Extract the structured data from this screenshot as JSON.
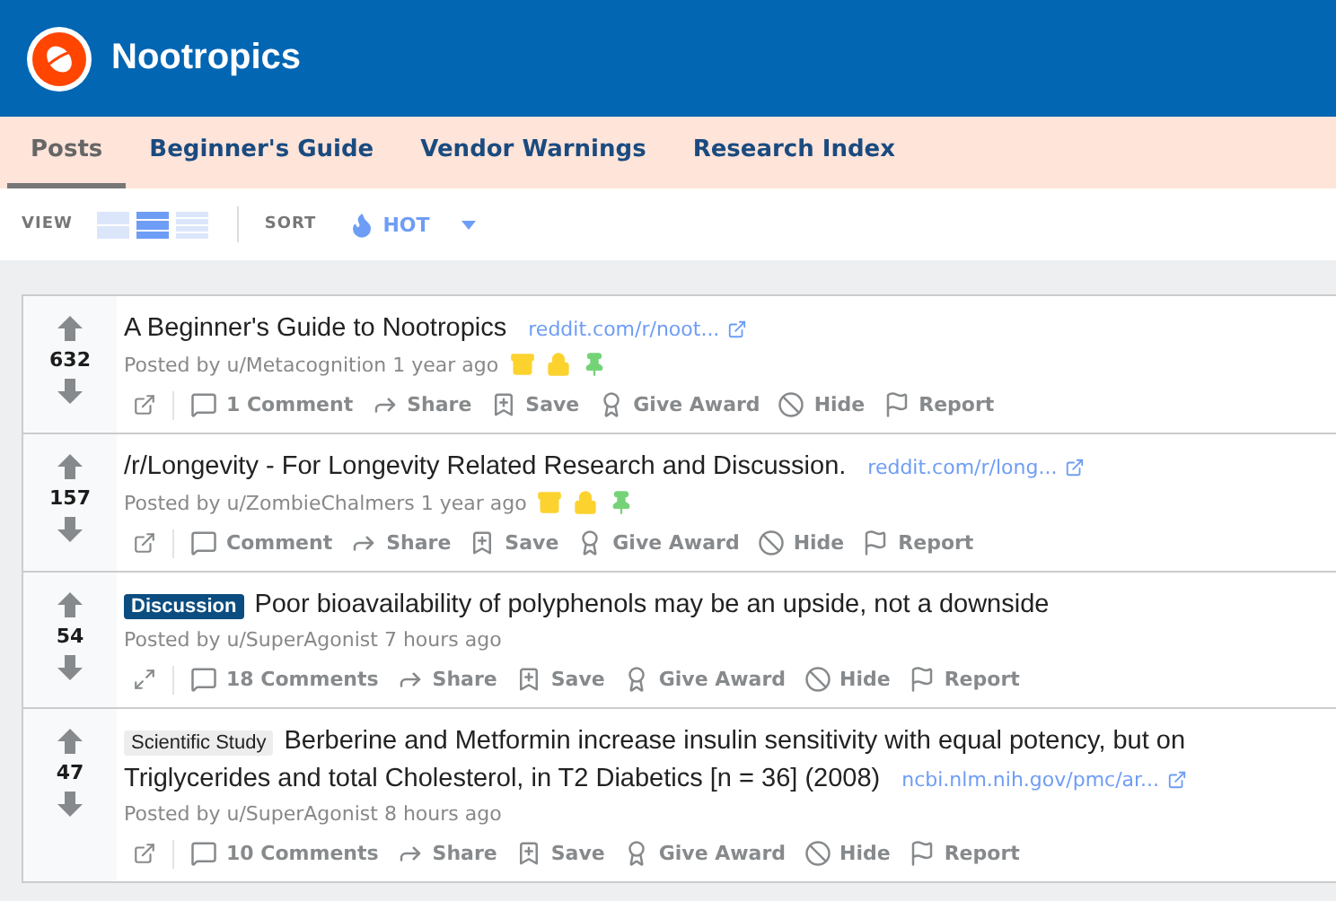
{
  "header": {
    "title": "Nootropics"
  },
  "tabs": [
    {
      "label": "Posts",
      "selected": true
    },
    {
      "label": "Beginner's Guide",
      "selected": false
    },
    {
      "label": "Vendor Warnings",
      "selected": false
    },
    {
      "label": "Research Index",
      "selected": false
    }
  ],
  "toolbar": {
    "view_label": "VIEW",
    "views": [
      {
        "kind": "card",
        "selected": false
      },
      {
        "kind": "classic",
        "selected": true
      },
      {
        "kind": "compact",
        "selected": false
      }
    ],
    "sort_label": "SORT",
    "sort_value": "HOT"
  },
  "posts": [
    {
      "votes": "632",
      "title_lines": [
        "A Beginner's Guide to Nootropics"
      ],
      "domain": "reddit.com/r/noot...",
      "meta": "Posted by u/Metacognition 1 year ago",
      "badges": [
        {
          "kind": "archived"
        },
        {
          "kind": "locked"
        },
        {
          "kind": "pinned"
        }
      ],
      "open_button": {
        "kind": "external"
      },
      "actions": [
        {
          "kind": "comment",
          "label": "1 Comment"
        },
        {
          "kind": "share",
          "label": "Share"
        },
        {
          "kind": "save",
          "label": "Save"
        },
        {
          "kind": "award",
          "label": "Give Award"
        },
        {
          "kind": "hide",
          "label": "Hide"
        },
        {
          "kind": "report",
          "label": "Report"
        }
      ]
    },
    {
      "votes": "157",
      "title_lines": [
        "/r/Longevity - For Longevity Related Research and Discussion."
      ],
      "domain": "reddit.com/r/long...",
      "meta": "Posted by u/ZombieChalmers 1 year ago",
      "badges": [
        {
          "kind": "archived"
        },
        {
          "kind": "locked"
        },
        {
          "kind": "pinned"
        }
      ],
      "open_button": {
        "kind": "external"
      },
      "actions": [
        {
          "kind": "comment",
          "label": "Comment"
        },
        {
          "kind": "share",
          "label": "Share"
        },
        {
          "kind": "save",
          "label": "Save"
        },
        {
          "kind": "award",
          "label": "Give Award"
        },
        {
          "kind": "hide",
          "label": "Hide"
        },
        {
          "kind": "report",
          "label": "Report"
        }
      ]
    },
    {
      "votes": "54",
      "flair": {
        "text": "Discussion",
        "kind": "dark"
      },
      "title_lines": [
        "Poor bioavailability of polyphenols may be an upside, not a downside"
      ],
      "meta": "Posted by u/SuperAgonist 7 hours ago",
      "open_button": {
        "kind": "expand"
      },
      "actions": [
        {
          "kind": "comment",
          "label": "18 Comments"
        },
        {
          "kind": "share",
          "label": "Share"
        },
        {
          "kind": "save",
          "label": "Save"
        },
        {
          "kind": "award",
          "label": "Give Award"
        },
        {
          "kind": "hide",
          "label": "Hide"
        },
        {
          "kind": "report",
          "label": "Report"
        }
      ]
    },
    {
      "votes": "47",
      "flair": {
        "text": "Scientific Study",
        "kind": "light"
      },
      "title_lines": [
        "Berberine and Metformin increase insulin sensitivity with equal potency, but on",
        "Triglycerides and total Cholesterol, in T2 Diabetics [n = 36] (2008)"
      ],
      "domain": "ncbi.nlm.nih.gov/pmc/ar...",
      "meta": "Posted by u/SuperAgonist 8 hours ago",
      "open_button": {
        "kind": "external"
      },
      "actions": [
        {
          "kind": "comment",
          "label": "10 Comments"
        },
        {
          "kind": "share",
          "label": "Share"
        },
        {
          "kind": "save",
          "label": "Save"
        },
        {
          "kind": "award",
          "label": "Give Award"
        },
        {
          "kind": "hide",
          "label": "Hide"
        },
        {
          "kind": "report",
          "label": "Report"
        }
      ]
    }
  ]
}
